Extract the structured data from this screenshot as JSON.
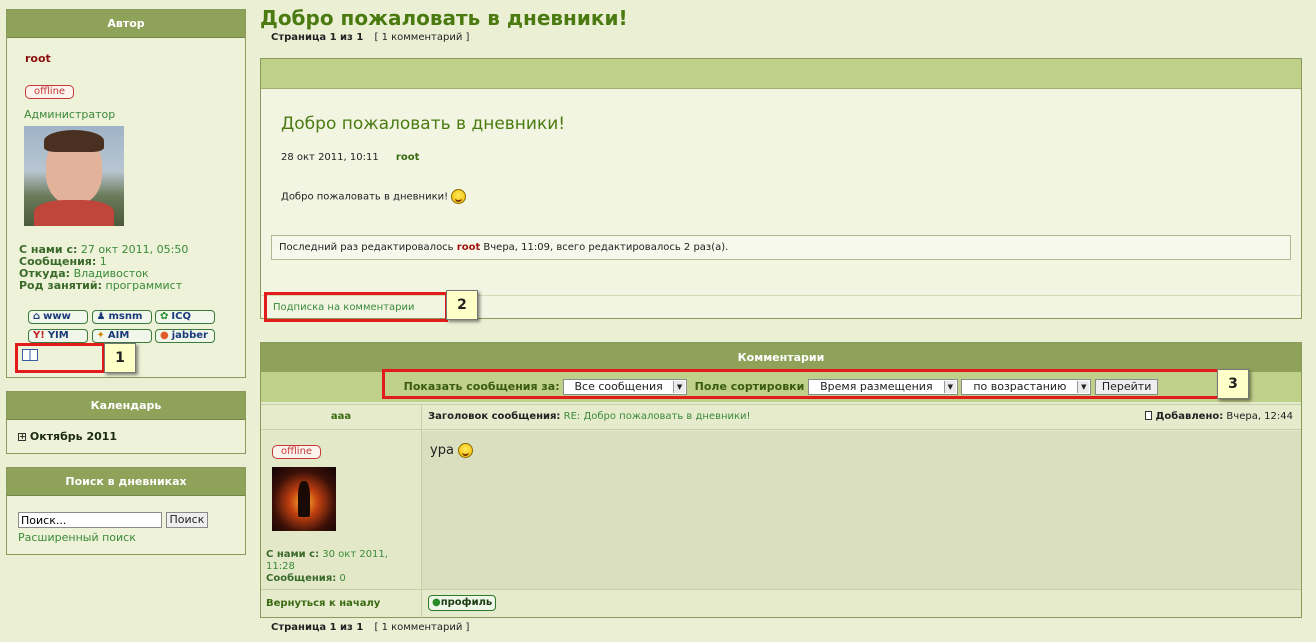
{
  "author_panel": {
    "title": "Автор",
    "username": "root",
    "status": "offline",
    "role": "Администратор",
    "joined_label": "С нами с:",
    "joined_value": "27 окт 2011, 05:50",
    "posts_label": "Сообщения:",
    "posts_value": "1",
    "from_label": "Откуда:",
    "from_value": "Владивосток",
    "occupation_label": "Род занятий:",
    "occupation_value": "программист",
    "im_buttons": [
      {
        "label": "www",
        "icon": "home-icon"
      },
      {
        "label": "msnm",
        "icon": "msn-icon"
      },
      {
        "label": "ICQ",
        "icon": "icq-flower-icon"
      },
      {
        "label": "YIM",
        "icon": "yahoo-icon"
      },
      {
        "label": "AIM",
        "icon": "aim-runner-icon"
      },
      {
        "label": "jabber",
        "icon": "jabber-bulb-icon"
      }
    ],
    "book_icon": "book-icon"
  },
  "calendar_panel": {
    "title": "Календарь",
    "month": "Октябрь 2011"
  },
  "search_panel": {
    "title": "Поиск в дневниках",
    "input_value": "Поиск...",
    "button_label": "Поиск",
    "advanced_link": "Расширенный поиск"
  },
  "page": {
    "title": "Добро пожаловать в дневники!",
    "pagination_label": "Страница 1 из 1",
    "comments_count": "[ 1 комментарий ]"
  },
  "entry": {
    "title": "Добро пожаловать в дневники!",
    "date": "28 окт 2011, 10:11",
    "author": "root",
    "body": "Добро пожаловать в дневники!",
    "edit_prefix": "Последний раз редактировалось",
    "edit_user": "root",
    "edit_suffix": "Вчера, 11:09, всего редактировалось 2 раз(а).",
    "subscribe_link": "Подписка на комментарии"
  },
  "comments": {
    "title": "Комментарии",
    "show_label": "Показать сообщения за:",
    "show_value": "Все сообщения",
    "sort_label": "Поле сортировки",
    "sort_value": "Время размещения",
    "order_value": "по возрастанию",
    "go_button": "Перейти",
    "post": {
      "author": "aaa",
      "subject_label": "Заголовок сообщения:",
      "subject_value": "RE: Добро пожаловать в дневники!",
      "added_label": "Добавлено:",
      "added_value": "Вчера, 12:44",
      "status": "offline",
      "body": "ура",
      "joined_label": "С нами с:",
      "joined_value": "30 окт 2011, 11:28",
      "posts_label": "Сообщения:",
      "posts_value": "0",
      "back_link": "Вернуться к началу",
      "profile_button": "профиль"
    }
  },
  "callouts": {
    "one": "1",
    "two": "2",
    "three": "3"
  },
  "colors": {
    "background": "#ebf0d5",
    "header_green": "#8fa25a",
    "title_green": "#4a7a10",
    "highlight_red": "#e21b1b"
  }
}
